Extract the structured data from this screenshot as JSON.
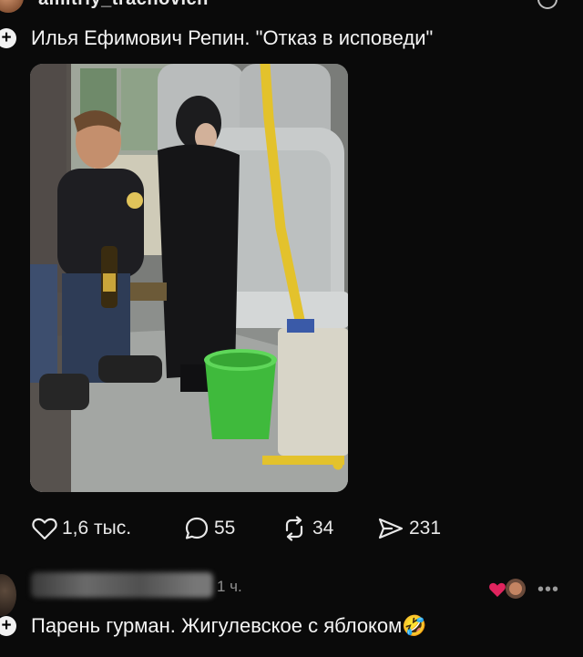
{
  "post": {
    "author_username": "amitriy_trachovich",
    "text": "Илья Ефимович Репин. \"Отказ в исповеди\"",
    "follow_symbol": "+"
  },
  "actions": {
    "likes": "1,6 тыс.",
    "comments": "55",
    "reposts": "34",
    "shares": "231"
  },
  "comment": {
    "time": "1 ч.",
    "text": "Парень гурман. Жигулевское с яблоком🤣",
    "follow_symbol": "+",
    "more_symbol": "•••"
  },
  "colors": {
    "background": "#0a0a0a",
    "text": "#f2f2f2",
    "muted": "#8f8f8f",
    "heart": "#e0245e"
  }
}
